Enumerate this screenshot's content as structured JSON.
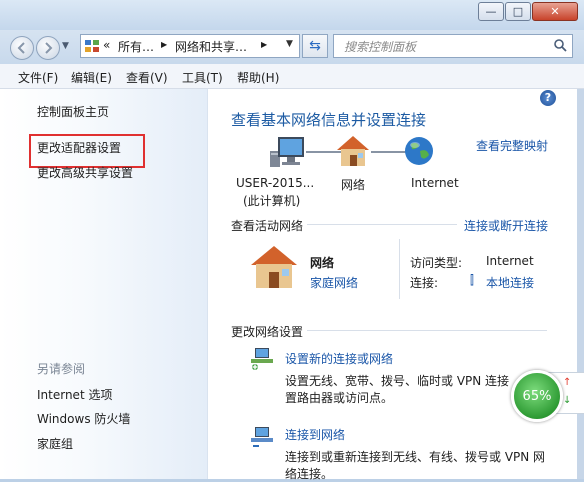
{
  "window": {
    "minimize_glyph": "—",
    "maximize_glyph": "□",
    "close_glyph": "✕"
  },
  "nav": {
    "breadcrumb": [
      "«",
      "所有…",
      "▶",
      "网络和共享…",
      "▶"
    ],
    "search_placeholder": "搜索控制面板"
  },
  "menu": [
    "文件(F)",
    "编辑(E)",
    "查看(V)",
    "工具(T)",
    "帮助(H)"
  ],
  "sidebar": {
    "home": "控制面板主页",
    "items": [
      "更改适配器设置",
      "更改高级共享设置"
    ],
    "see_also_title": "另请参阅",
    "see_also": [
      "Internet 选项",
      "Windows 防火墙",
      "家庭组"
    ]
  },
  "main": {
    "title": "查看基本网络信息并设置连接",
    "full_map_link": "查看完整映射",
    "map": {
      "computer_label_1": "USER-2015...",
      "computer_label_2": "(此计算机)",
      "network_label": "网络",
      "internet_label": "Internet"
    },
    "active_section_title": "查看活动网络",
    "connect_link": "连接或断开连接",
    "active": {
      "name": "网络",
      "type": "家庭网络",
      "access_label": "访问类型:",
      "access_value": "Internet",
      "conn_label": "连接:",
      "conn_value": "本地连接"
    },
    "change_section_title": "更改网络设置",
    "tasks": [
      {
        "title": "设置新的连接或网络",
        "desc1": "设置无线、宽带、拨号、临时或 VPN 连接",
        "desc2": "置路由器或访问点。"
      },
      {
        "title": "连接到网络",
        "desc1": "连接到或重新连接到无线、有线、拨号或 VPN 网",
        "desc2": "络连接。"
      }
    ]
  },
  "widget": {
    "percent": "65%"
  },
  "colors": {
    "link": "#1a56a8",
    "title": "#1d5ba3",
    "highlight_box": "#e03030",
    "gauge": "#2e9b34"
  }
}
